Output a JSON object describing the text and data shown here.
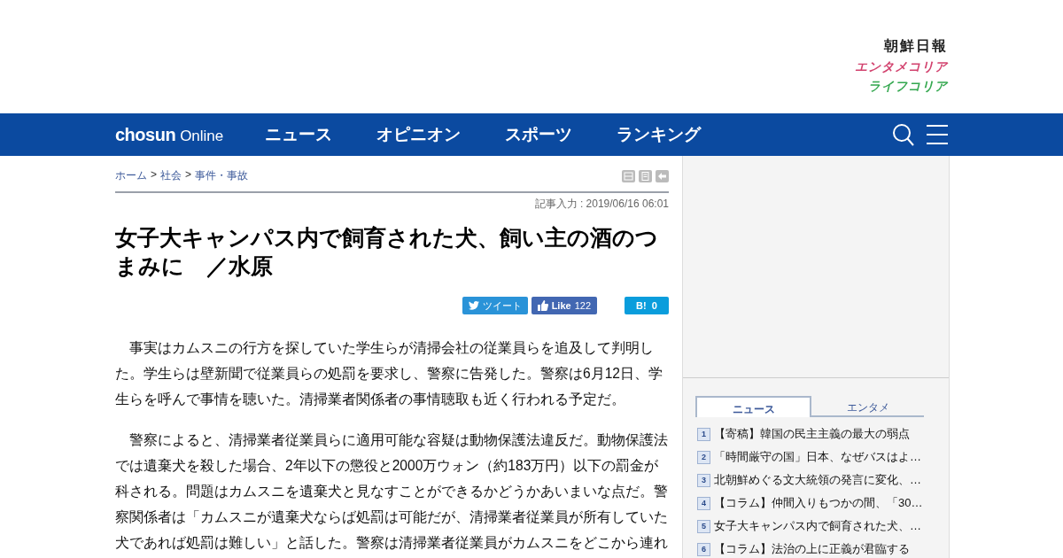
{
  "header": {
    "logos": [
      "朝鮮日報",
      "エンタメコリア",
      "ライフコリア"
    ]
  },
  "nav": {
    "brand": {
      "main": "chosun",
      "sub": "Online"
    },
    "items": [
      "ニュース",
      "オピニオン",
      "スポーツ",
      "ランキング"
    ]
  },
  "breadcrumb": {
    "links": [
      "ホーム",
      "社会",
      "事件・事故"
    ],
    "separator": ">"
  },
  "article": {
    "timestamp": "記事入力 : 2019/06/16 06:01",
    "title": "女子大キャンパス内で飼育された犬、飼い主の酒のつまみに　／水原",
    "share": [
      {
        "kind": "tweet",
        "label": "ツイート"
      },
      {
        "kind": "like",
        "label": "Like",
        "count": "122"
      },
      {
        "kind": "hatena",
        "label": "B!",
        "count": "0"
      }
    ],
    "paragraphs": [
      "事実はカムスニの行方を探していた学生らが清掃会社の従業員らを追及して判明した。学生らは壁新聞で従業員らの処罰を要求し、警察に告発した。警察は6月12日、学生らを呼んで事情を聴いた。清掃業者関係者の事情聴取も近く行われる予定だ。",
      "警察によると、清掃業者従業員らに適用可能な容疑は動物保護法違反だ。動物保護法では遺棄犬を殺した場合、2年以下の懲役と2000万ウォン（約183万円）以下の罰金が科される。問題はカムスニを遺棄犬と見なすことができるかどうかあいまいな点だ。警察関係者は「カムスニが遺棄犬ならば処罰は可能だが、清掃業者従業員が所有していた犬であれば処罰は難しい」と話した。警察は清掃業者従業員がカムスニをどこから連れ"
    ]
  },
  "ranking": {
    "tabs": [
      {
        "label": "ニュース",
        "selected": true
      },
      {
        "label": "エンタメ",
        "selected": false
      }
    ],
    "items": [
      {
        "rank": "1",
        "title": "【寄稿】韓国の民主主義の最大の弱点"
      },
      {
        "rank": "2",
        "title": "「時間厳守の国」日本、なぜバスはよ…"
      },
      {
        "rank": "3",
        "title": "北朝鮮めぐる文大統領の発言に変化、…"
      },
      {
        "rank": "4",
        "title": "【コラム】仲間入りもつかの間、「30…"
      },
      {
        "rank": "5",
        "title": "女子大キャンパス内で飼育された犬、…"
      },
      {
        "rank": "6",
        "title": "【コラム】法治の上に正義が君臨する"
      }
    ]
  }
}
